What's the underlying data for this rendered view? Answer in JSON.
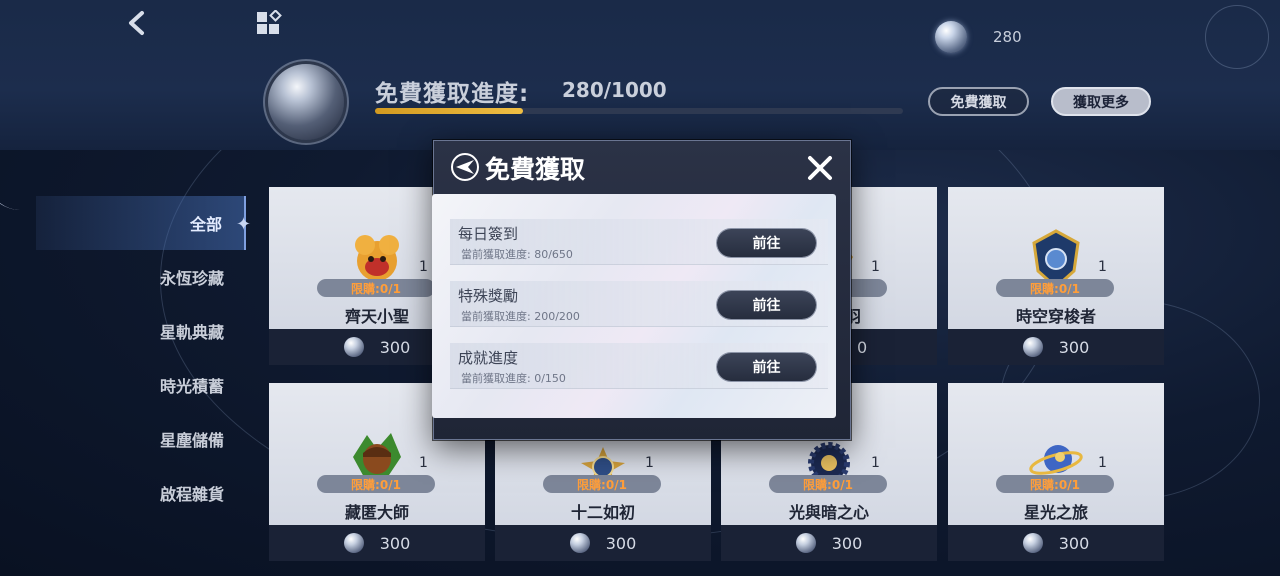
{
  "header": {
    "currency_amount": "280",
    "progress_title": "免費獲取進度:",
    "progress_value": "280/1000",
    "progress_fraction": 0.28,
    "free_button": "免費獲取",
    "more_button": "獲取更多"
  },
  "sidebar": {
    "items": [
      {
        "label": "全部",
        "active": true
      },
      {
        "label": "永恆珍藏"
      },
      {
        "label": "星軌典藏"
      },
      {
        "label": "時光積蓄"
      },
      {
        "label": "星塵儲備"
      },
      {
        "label": "啟程雜貨"
      }
    ]
  },
  "cards": [
    {
      "name": "齊天小聖",
      "count": "1",
      "limit": "限購:0/1",
      "price": "300",
      "icon": "monkey-king-badge-icon"
    },
    {
      "name": "",
      "count": "",
      "limit": "",
      "price": "",
      "icon": ""
    },
    {
      "name": "羽",
      "count": "1",
      "limit": "1",
      "price": "0",
      "icon": "wing-badge-icon"
    },
    {
      "name": "時空穿梭者",
      "count": "1",
      "limit": "限購:0/1",
      "price": "300",
      "icon": "shield-badge-icon"
    },
    {
      "name": "藏匿大師",
      "count": "1",
      "limit": "限購:0/1",
      "price": "300",
      "icon": "acorn-badge-icon"
    },
    {
      "name": "十二如初",
      "count": "1",
      "limit": "限購:0/1",
      "price": "300",
      "icon": "twelve-badge-icon"
    },
    {
      "name": "光與暗之心",
      "count": "1",
      "limit": "限購:0/1",
      "price": "300",
      "icon": "sun-badge-icon"
    },
    {
      "name": "星光之旅",
      "count": "1",
      "limit": "限購:0/1",
      "price": "300",
      "icon": "planet-badge-icon"
    }
  ],
  "modal": {
    "title": "免費獲取",
    "tasks": [
      {
        "name": "每日簽到",
        "progress": "當前獲取進度: 80/650",
        "button": "前往"
      },
      {
        "name": "特殊獎勵",
        "progress": "當前獲取進度: 200/200",
        "button": "前往"
      },
      {
        "name": "成就進度",
        "progress": "當前獲取進度: 0/150",
        "button": "前往"
      }
    ]
  },
  "colors": {
    "accent_gold": "#f0bf45",
    "limit_text": "#ff9e3a",
    "background": "#0f1a30"
  }
}
